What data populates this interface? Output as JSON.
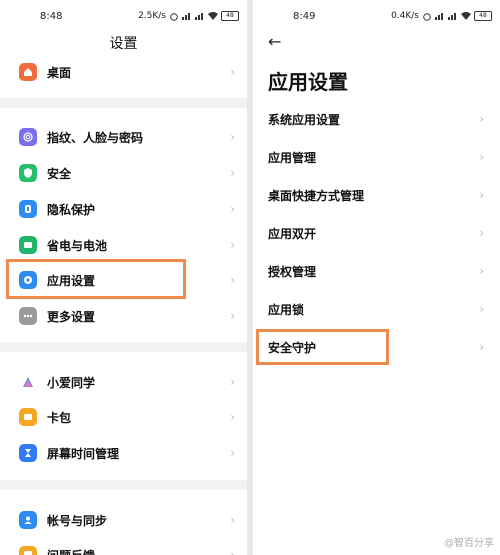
{
  "left": {
    "status": {
      "time": "8:48",
      "speed": "2.5K/s",
      "battery": "48"
    },
    "title": "设置",
    "items": [
      {
        "label": "桌面",
        "color": "#f26b3a",
        "icon": "home-icon"
      },
      {
        "label": "指纹、人脸与密码",
        "color": "#7b6ef0",
        "icon": "fingerprint-icon"
      },
      {
        "label": "安全",
        "color": "#27c06a",
        "icon": "shield-icon"
      },
      {
        "label": "隐私保护",
        "color": "#2f8cf5",
        "icon": "privacy-icon"
      },
      {
        "label": "省电与电池",
        "color": "#22b46a",
        "icon": "battery-icon"
      },
      {
        "label": "应用设置",
        "color": "#2f8cf5",
        "icon": "gear-icon"
      },
      {
        "label": "更多设置",
        "color": "#9a9a9a",
        "icon": "more-icon"
      },
      {
        "label": "小爱同学",
        "color": "#ffffff",
        "icon": "xiaoai-icon"
      },
      {
        "label": "卡包",
        "color": "#f5a623",
        "icon": "wallet-icon"
      },
      {
        "label": "屏幕时间管理",
        "color": "#2f7cf5",
        "icon": "hourglass-icon"
      },
      {
        "label": "帐号与同步",
        "color": "#2f8cf5",
        "icon": "account-icon"
      },
      {
        "label": "问题反馈",
        "color": "#f5a623",
        "icon": "feedback-icon"
      }
    ]
  },
  "right": {
    "status": {
      "time": "8:49",
      "speed": "0.4K/s",
      "battery": "48"
    },
    "back": "←",
    "title": "应用设置",
    "items": [
      {
        "label": "系统应用设置"
      },
      {
        "label": "应用管理"
      },
      {
        "label": "桌面快捷方式管理"
      },
      {
        "label": "应用双开"
      },
      {
        "label": "授权管理"
      },
      {
        "label": "应用锁"
      },
      {
        "label": "安全守护"
      }
    ]
  },
  "chevron": "›",
  "highlight_color": "#ee8a4e",
  "watermark": "@智百分享"
}
